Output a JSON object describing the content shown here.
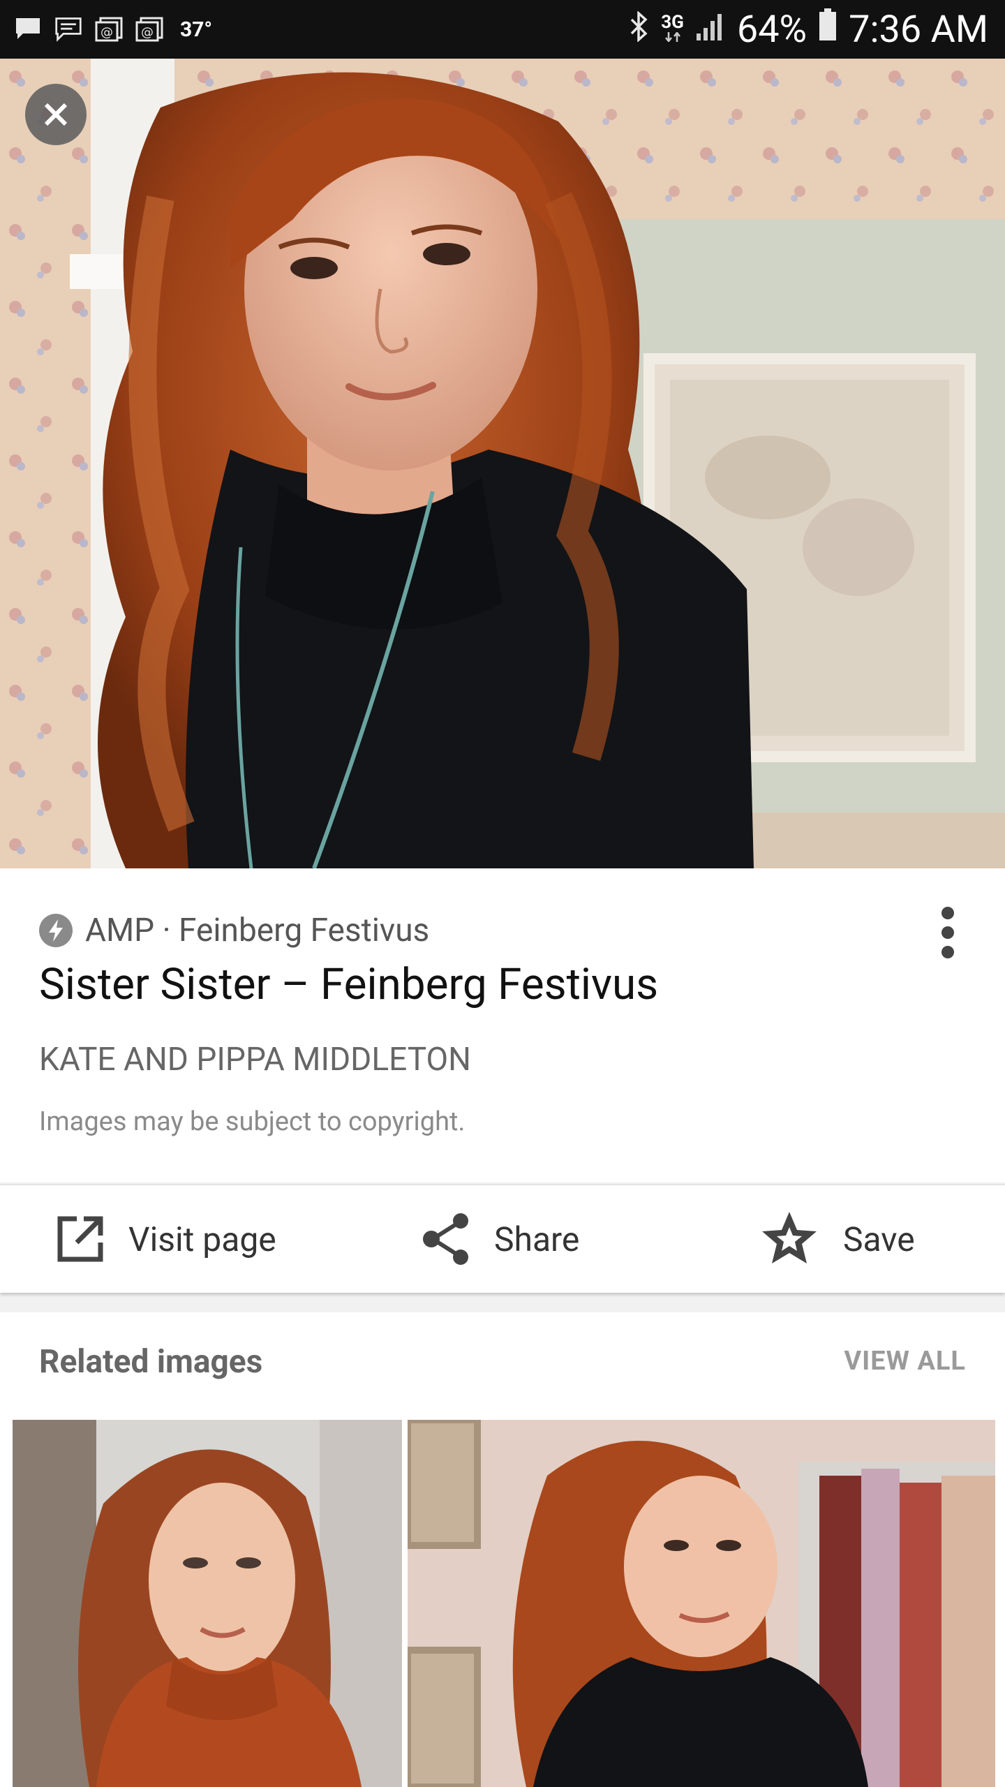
{
  "status_bar": {
    "temperature": "37°",
    "network": "3G",
    "battery": "64%",
    "time": "7:36 AM"
  },
  "result": {
    "source": "AMP · Feinberg Festivus",
    "title": "Sister Sister – Feinberg Festivus",
    "subtitle": "KATE AND PIPPA MIDDLETON",
    "copyright": "Images may be subject to copyright."
  },
  "actions": {
    "visit_label": "Visit page",
    "share_label": "Share",
    "save_label": "Save"
  },
  "related": {
    "title": "Related images",
    "view_all": "VIEW ALL"
  },
  "icons": {
    "close": "close-icon",
    "amp": "amp-bolt-icon",
    "more": "more-vert-icon",
    "visit": "open-in-new-icon",
    "share": "share-icon",
    "save": "star-icon"
  }
}
